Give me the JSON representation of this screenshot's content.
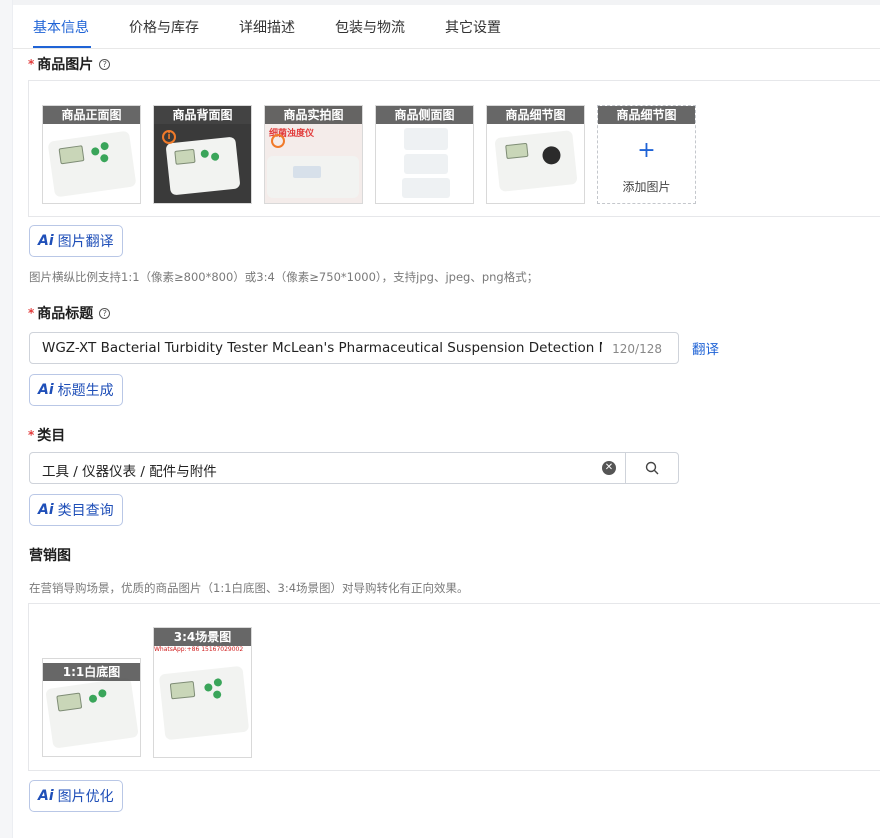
{
  "tabs": [
    {
      "label": "基本信息"
    },
    {
      "label": "价格与库存"
    },
    {
      "label": "详细描述"
    },
    {
      "label": "包装与物流"
    },
    {
      "label": "其它设置"
    }
  ],
  "images_section": {
    "required_mark": "*",
    "label": "商品图片",
    "help_icon": "question-circle-icon",
    "thumbnails": [
      {
        "caption": "商品正面图"
      },
      {
        "caption": "商品背面图"
      },
      {
        "caption": "商品实拍图"
      },
      {
        "caption": "商品侧面图"
      },
      {
        "caption": "商品细节图"
      }
    ],
    "add_slot": {
      "caption": "商品细节图",
      "plus": "+",
      "label": "添加图片"
    },
    "ai_button": {
      "badge": "Ai",
      "label": "图片翻译"
    },
    "hint": "图片横纵比例支持1:1（像素≥800*800）或3:4（像素≥750*1000），支持jpg、jpeg、png格式；"
  },
  "title_section": {
    "required_mark": "*",
    "label": "商品标题",
    "value": "WGZ-XT Bacterial Turbidity Tester McLean's Pharmaceutical Suspension Detection McLean's",
    "count": "120/128",
    "translate_link": "翻译",
    "ai_button": {
      "badge": "Ai",
      "label": "标题生成"
    }
  },
  "category_section": {
    "required_mark": "*",
    "label": "类目",
    "value": "工具 / 仪器仪表 / 配件与附件",
    "clear_icon": "clear-circle-icon",
    "search_icon": "search-icon",
    "ai_button": {
      "badge": "Ai",
      "label": "类目查询"
    }
  },
  "marketing_section": {
    "label": "营销图",
    "hint": "在营销导购场景，优质的商品图片（1:1白底图、3:4场景图）对导购转化有正向效果。",
    "images": [
      {
        "caption": "1:1白底图"
      },
      {
        "caption": "3:4场景图",
        "watermark": "WhatsApp:+86 15167029002"
      }
    ],
    "ai_button": {
      "badge": "Ai",
      "label": "图片优化"
    }
  },
  "colors": {
    "accent": "#1f63d6",
    "required": "#e23c3c",
    "ai": "#1f4fb8"
  }
}
